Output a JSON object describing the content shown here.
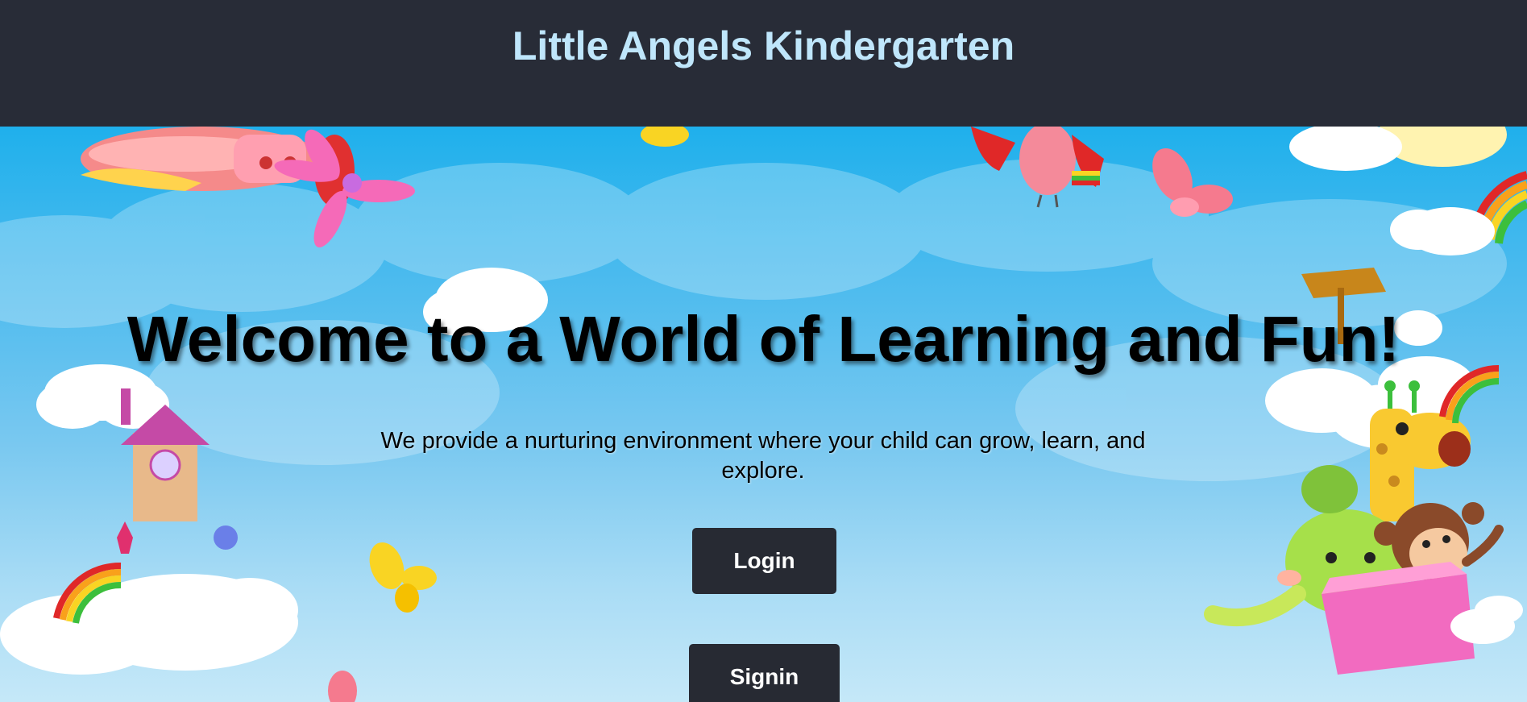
{
  "header": {
    "title": "Little Angels Kindergarten"
  },
  "hero": {
    "heading": "Welcome to a World of Learning and Fun!",
    "tagline": "We provide a nurturing environment where your child can grow, learn, and explore.",
    "login_label": "Login",
    "signin_label": "Signin"
  },
  "colors": {
    "header_bg": "#282c37",
    "title_color": "#bfe6fb",
    "button_bg": "#272a33",
    "button_text": "#ffffff",
    "sky": "#49baee"
  },
  "icons": [
    "airplane-icon",
    "bird-icon",
    "butterfly-icon",
    "rainbow-icon",
    "cloud-icon",
    "house-icon",
    "giraffe-icon",
    "monkey-icon",
    "elephant-icon",
    "flower-icon"
  ]
}
